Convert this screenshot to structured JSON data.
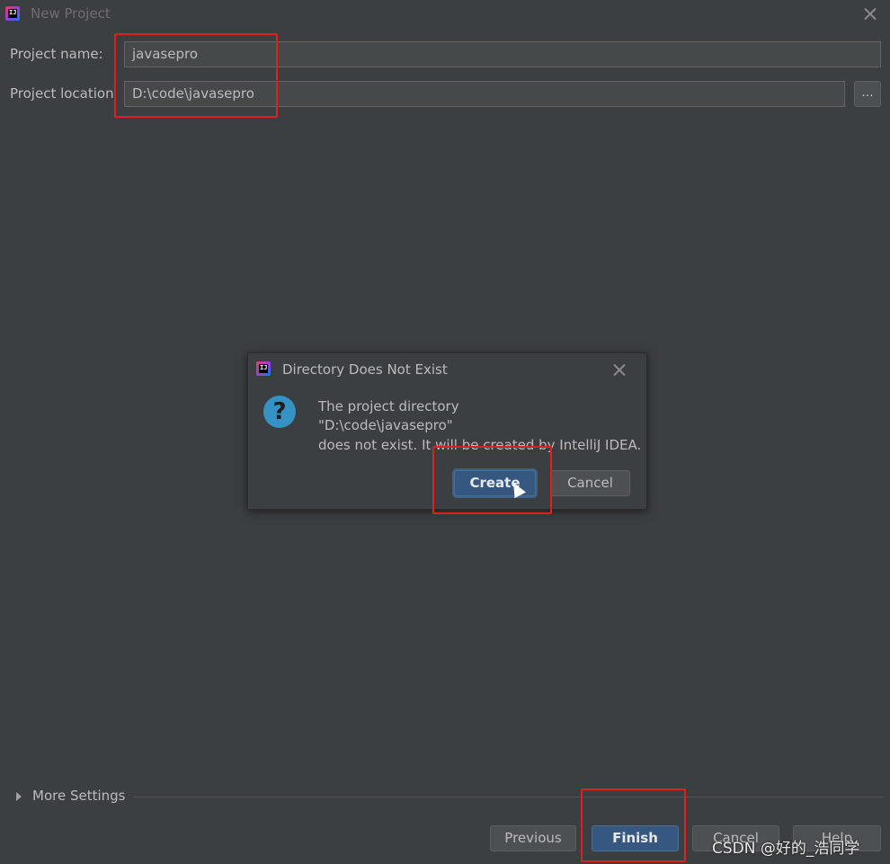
{
  "window": {
    "title": "New Project"
  },
  "form": {
    "project_name_label": "Project name:",
    "project_name_value": "javasepro",
    "project_location_label": "Project location",
    "project_location_value": "D:\\code\\javasepro",
    "browse_label": "..."
  },
  "dialog": {
    "title": "Directory Does Not Exist",
    "message_line1": "The project directory",
    "message_line2": "\"D:\\code\\javasepro\"",
    "message_line3": "does not exist. It will be created by IntelliJ IDEA.",
    "create_label": "Create",
    "cancel_label": "Cancel",
    "icon": "question-icon"
  },
  "footer": {
    "more_settings_label": "More Settings",
    "previous_label": "Previous",
    "finish_label": "Finish",
    "cancel_label": "Cancel",
    "help_label": "Help"
  },
  "watermark": "CSDN @好的_浩同学",
  "colors": {
    "background": "#3c3f41",
    "field_background": "#45494a",
    "primary_button": "#365880",
    "highlight_box": "#e02020",
    "question_icon": "#3592c4"
  }
}
